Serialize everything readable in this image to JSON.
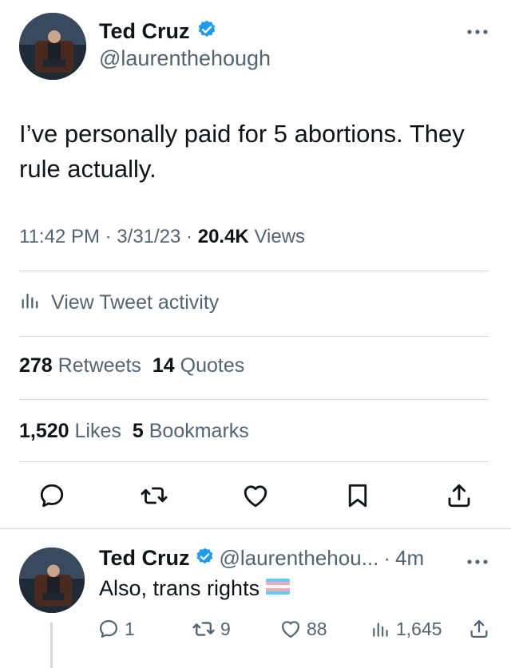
{
  "tweet": {
    "author_name": "Ted Cruz",
    "handle": "@laurenthehough",
    "text": "I’ve personally paid for 5 abortions. They rule actually.",
    "time": "11:42 PM",
    "date": "3/31/23",
    "views_count": "20.4K",
    "views_label": "Views",
    "activity_label": "View Tweet activity",
    "retweets_count": "278",
    "retweets_label": "Retweets",
    "quotes_count": "14",
    "quotes_label": "Quotes",
    "likes_count": "1,520",
    "likes_label": "Likes",
    "bookmarks_count": "5",
    "bookmarks_label": "Bookmarks"
  },
  "reply": {
    "author_name": "Ted Cruz",
    "handle": "@laurenthehou...",
    "time": "4m",
    "text": "Also, trans rights",
    "replies": "1",
    "retweets": "9",
    "likes": "88",
    "views": "1,645"
  },
  "icons": {
    "verified": "verified-badge-icon",
    "more": "more-dots-icon",
    "activity": "bar-chart-icon",
    "reply": "reply-icon",
    "retweet": "retweet-icon",
    "like": "heart-icon",
    "bookmark": "bookmark-icon",
    "share": "share-icon",
    "flag": "trans-flag-emoji"
  },
  "colors": {
    "text": "#0f1419",
    "secondary": "#536471",
    "verified": "#1d9bf0",
    "divider": "#cfd9de"
  }
}
